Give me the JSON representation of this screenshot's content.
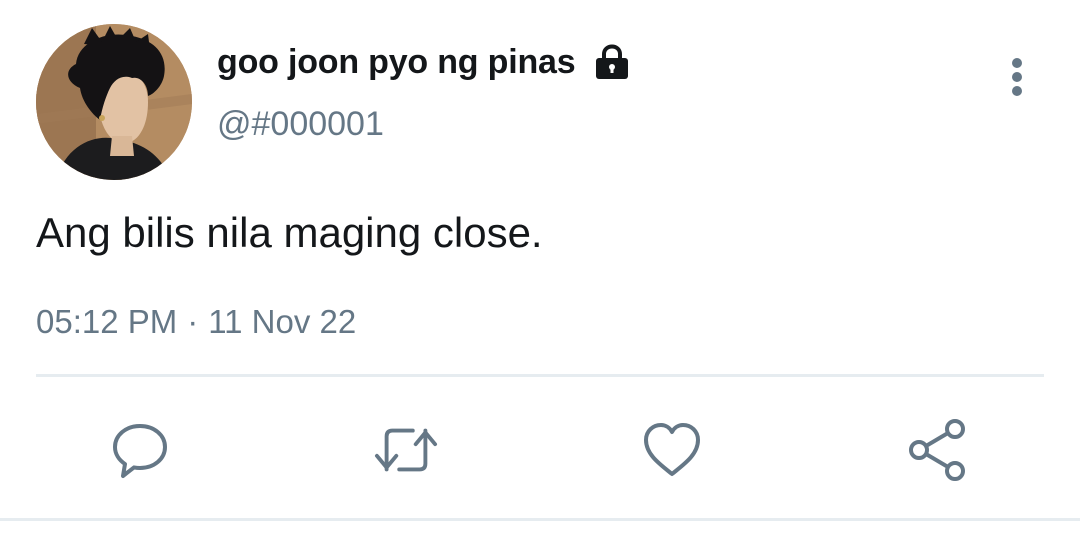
{
  "tweet": {
    "display_name": "goo joon pyo ng pinas",
    "handle": "@#000001",
    "text": "Ang bilis nila maging close.",
    "time": "05:12 PM",
    "separator": "·",
    "date": "11 Nov 22"
  },
  "icons": {
    "lock": "lock-icon",
    "more": "more-vertical-icon",
    "reply": "reply-icon",
    "retweet": "retweet-icon",
    "like": "heart-icon",
    "share": "share-icon"
  },
  "colors": {
    "text_primary": "#14171a",
    "text_secondary": "#657786",
    "divider": "#e6ecf0"
  }
}
